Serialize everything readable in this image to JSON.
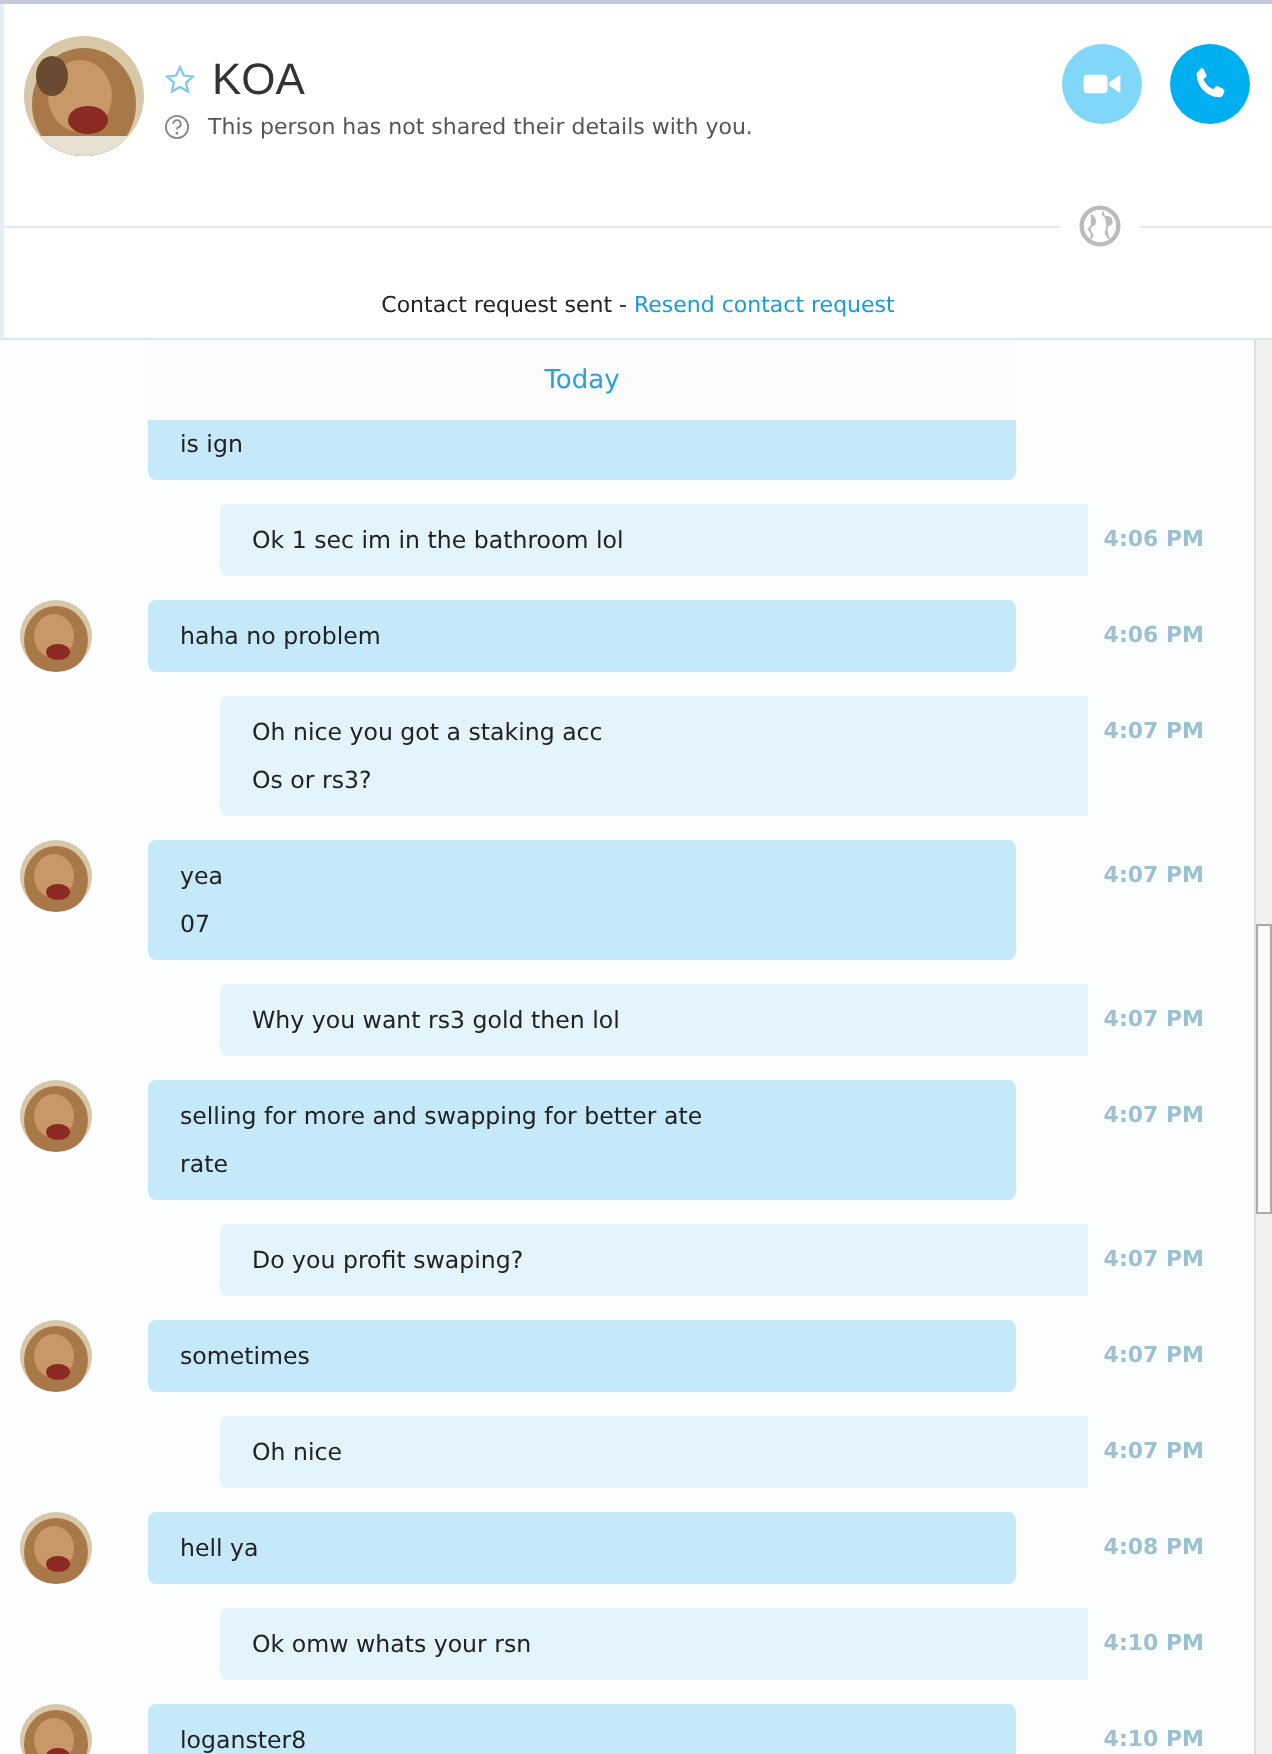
{
  "contact": {
    "name": "KOA",
    "starred": false,
    "status": "This person has not shared their details with you."
  },
  "calls": [
    {
      "kind": "video",
      "enabled": false
    },
    {
      "kind": "audio",
      "enabled": true
    }
  ],
  "request": {
    "text": "Contact request sent - ",
    "link": "Resend contact request"
  },
  "date_separator": "Today",
  "messages": [
    {
      "kind": "incoming",
      "lines": [
        "is ign"
      ],
      "avatar": false
    },
    {
      "kind": "outgoing",
      "lines": [
        "Ok 1 sec im in the bathroom lol"
      ],
      "time": "4:06 PM"
    },
    {
      "kind": "incoming",
      "lines": [
        "haha no problem"
      ],
      "time": "4:06 PM",
      "avatar": true
    },
    {
      "kind": "outgoing",
      "lines": [
        "Oh nice you got a staking acc",
        "Os or rs3?"
      ],
      "time": "4:07 PM"
    },
    {
      "kind": "incoming",
      "lines": [
        "yea",
        "07"
      ],
      "time": "4:07 PM",
      "avatar": true
    },
    {
      "kind": "outgoing",
      "lines": [
        "Why you want rs3 gold then lol"
      ],
      "time": "4:07 PM"
    },
    {
      "kind": "incoming",
      "lines": [
        "selling for more and swapping for better ate",
        "rate"
      ],
      "time": "4:07 PM",
      "avatar": true
    },
    {
      "kind": "outgoing",
      "lines": [
        "Do you profit swaping?"
      ],
      "time": "4:07 PM"
    },
    {
      "kind": "incoming",
      "lines": [
        "sometimes"
      ],
      "time": "4:07 PM",
      "avatar": true
    },
    {
      "kind": "outgoing",
      "lines": [
        "Oh nice"
      ],
      "time": "4:07 PM"
    },
    {
      "kind": "incoming",
      "lines": [
        "hell ya"
      ],
      "time": "4:08 PM",
      "avatar": true
    },
    {
      "kind": "outgoing",
      "lines": [
        "Ok omw whats your rsn"
      ],
      "time": "4:10 PM"
    },
    {
      "kind": "incoming",
      "lines": [
        "loganster8"
      ],
      "time": "4:10 PM",
      "avatar": true
    }
  ]
}
